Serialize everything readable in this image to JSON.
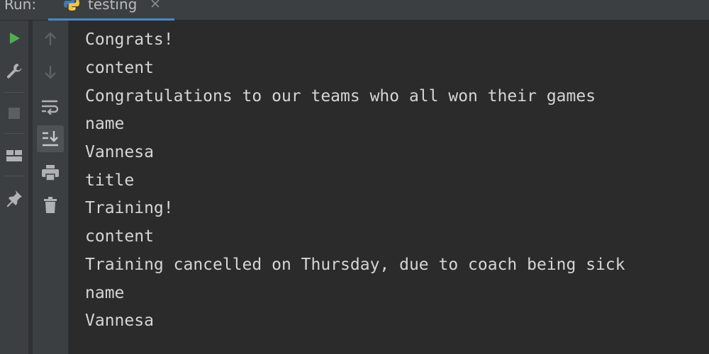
{
  "topbar": {
    "run_label": "Run:",
    "tab_label": "testing"
  },
  "toolbar": {
    "left_icons": [
      "run-icon",
      "wrench-icon",
      "stop-icon",
      "layout-icon",
      "pin-icon"
    ],
    "second_icons": [
      "up-arrow-icon",
      "down-arrow-icon",
      "soft-wrap-icon",
      "scroll-to-end-icon",
      "print-icon",
      "trash-icon"
    ]
  },
  "colors": {
    "run_green": "#4daf4f",
    "background": "#2b2b2b",
    "toolbar": "#3c3f41",
    "text": "#d5d5d5",
    "tab_underline": "#4a88c7"
  },
  "console": {
    "lines": [
      "Congrats!",
      "content",
      "Congratulations to our teams who all won their games",
      "name",
      "Vannesa",
      "title",
      "Training!",
      "content",
      "Training cancelled on Thursday, due to coach being sick",
      "name",
      "Vannesa"
    ]
  }
}
